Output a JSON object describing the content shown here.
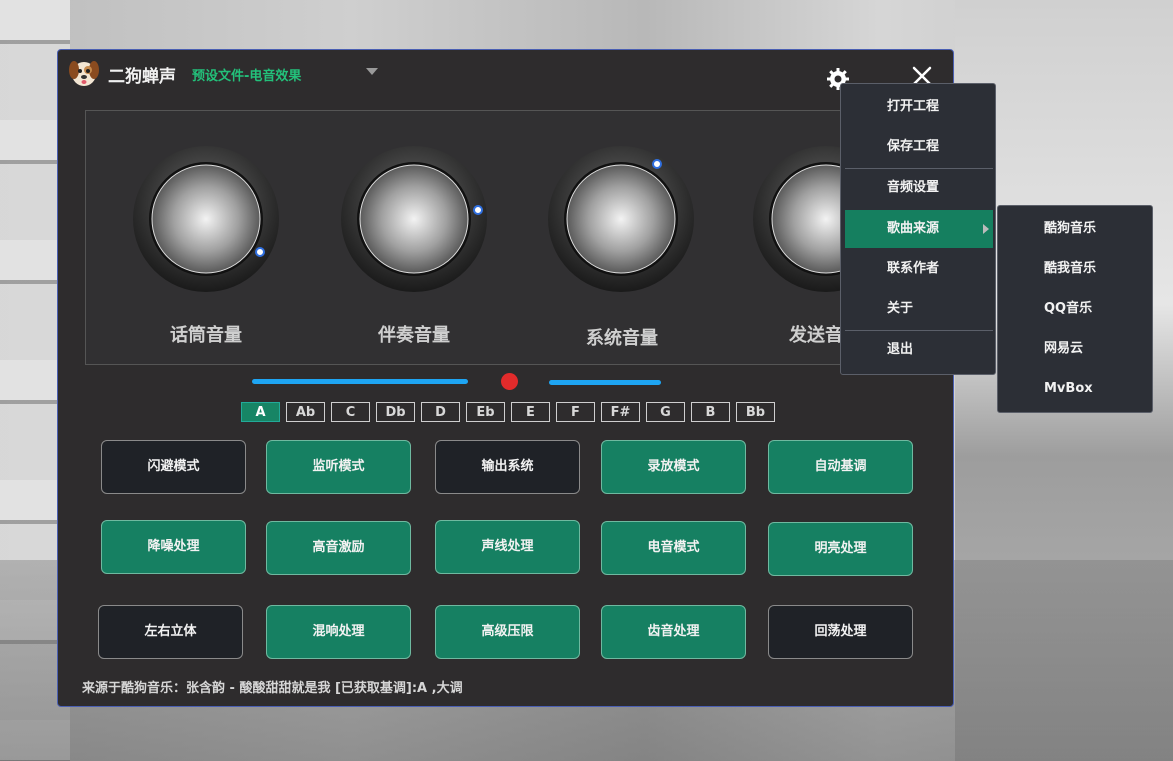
{
  "app": {
    "name": "二狗蝉声",
    "preset": "预设文件-电音效果"
  },
  "knobs": [
    {
      "label": "话筒音量"
    },
    {
      "label": "伴奏音量"
    },
    {
      "label": "系统音量"
    },
    {
      "label": "发送音"
    }
  ],
  "keys": [
    "A",
    "Ab",
    "C",
    "Db",
    "D",
    "Eb",
    "E",
    "F",
    "F#",
    "G",
    "B",
    "Bb"
  ],
  "selected_key": "A",
  "buttons": [
    {
      "label": "闪避模式",
      "on": false
    },
    {
      "label": "监听模式",
      "on": true
    },
    {
      "label": "输出系统",
      "on": false
    },
    {
      "label": "录放模式",
      "on": true
    },
    {
      "label": "自动基调",
      "on": true
    },
    {
      "label": "降噪处理",
      "on": true
    },
    {
      "label": "高音激励",
      "on": true
    },
    {
      "label": "声线处理",
      "on": true
    },
    {
      "label": "电音模式",
      "on": true
    },
    {
      "label": "明亮处理",
      "on": true
    },
    {
      "label": "左右立体",
      "on": false
    },
    {
      "label": "混响处理",
      "on": true
    },
    {
      "label": "高级压限",
      "on": true
    },
    {
      "label": "齿音处理",
      "on": true
    },
    {
      "label": "回荡处理",
      "on": false
    }
  ],
  "status_text": "来源于酷狗音乐：张含韵  -  酸酸甜甜就是我  [已获取基调]:A ,大调",
  "menu": {
    "items": [
      "打开工程",
      "保存工程",
      "音频设置",
      "歌曲来源",
      "联系作者",
      "关于",
      "退出"
    ],
    "highlighted": "歌曲来源"
  },
  "submenu": {
    "items": [
      "酷狗音乐",
      "酷我音乐",
      "QQ音乐",
      "网易云",
      "MvBox"
    ]
  },
  "colors": {
    "accent_green": "#168062",
    "preset_green": "#23c07a",
    "slider_blue": "#1ea5f3",
    "record_red": "#e22b2b"
  },
  "icons": {
    "settings": "gear-icon",
    "close": "close-icon",
    "logo": "dog-logo-icon",
    "dropdown": "chevron-down-icon"
  }
}
